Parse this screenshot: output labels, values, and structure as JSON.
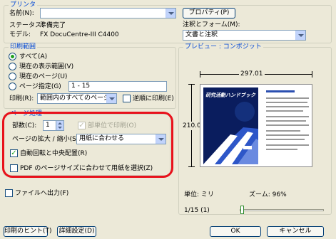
{
  "printer": {
    "title": "プリンタ",
    "name_label": "名前(N):",
    "name_value": "",
    "properties_button": "プロパティ(P)",
    "status_label": "ステータス:",
    "status_value": "準備完了",
    "model_label": "モデル:",
    "model_value": "FX DocuCentre-III C4400",
    "annot_label": "注釈とフォーム(M):",
    "annot_value": "文書と注釈"
  },
  "range": {
    "title": "印刷範囲",
    "all": "すべて(A)",
    "view": "現在の表示範囲(V)",
    "page": "現在のページ(U)",
    "pages": "ページ指定(G)",
    "pages_value": "1 - 15",
    "print_label": "印刷(R):",
    "print_value": "範囲内のすべてのページ",
    "reverse": "逆順に印刷(E)"
  },
  "handling": {
    "title": "ページ処理",
    "copies_label": "部数(C):",
    "copies_value": "1",
    "collate": "部単位で印刷(O)",
    "scale_label": "ページの拡大 / 縮小(S):",
    "scale_value": "用紙に合わせる",
    "autorotate": "自動回転と中央配置(R)",
    "pdf_size": "PDF のページサイズに合わせて用紙を選択(Z)"
  },
  "print_to_file": "ファイルへ出力(F)",
  "preview": {
    "title": "プレビュー : コンポジット",
    "width": "297.01",
    "height": "210.02",
    "units": "単位: ミリ",
    "zoom": "ズーム: 96%",
    "page": "1/15 (1)",
    "doc_title": "研究活動ハンドブック",
    "slider_value": 0
  },
  "footer": {
    "hints": "印刷のヒント(T)",
    "advanced": "詳細設定(D)",
    "ok": "OK",
    "cancel": "キャンセル"
  },
  "colors": {
    "accent": "#0046d5",
    "highlight": "#e8111b",
    "check": "#21a121"
  }
}
